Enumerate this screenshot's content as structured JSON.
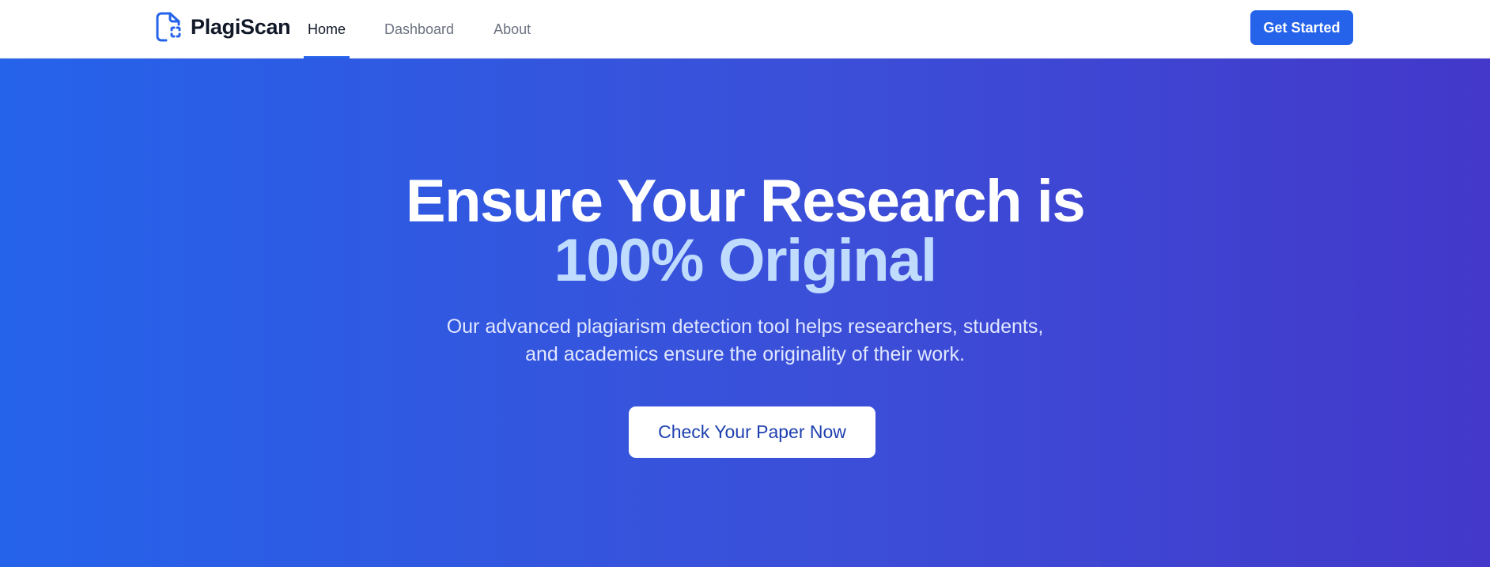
{
  "brand": {
    "name": "PlagiScan",
    "icon": "document-scan-icon",
    "icon_color": "#2563eb"
  },
  "nav": {
    "items": [
      {
        "label": "Home",
        "active": true
      },
      {
        "label": "Dashboard",
        "active": false
      },
      {
        "label": "About",
        "active": false
      }
    ],
    "cta_label": "Get Started"
  },
  "hero": {
    "title": "Ensure Your Research is",
    "highlight": "100% Original",
    "subtitle": "Our advanced plagiarism detection tool helps researchers, students, and academics ensure the originality of their work.",
    "cta_label": "Check Your Paper Now"
  },
  "colors": {
    "primary": "#2563eb",
    "gradient_end": "#4338ca",
    "highlight_text": "#bfdbfe"
  }
}
